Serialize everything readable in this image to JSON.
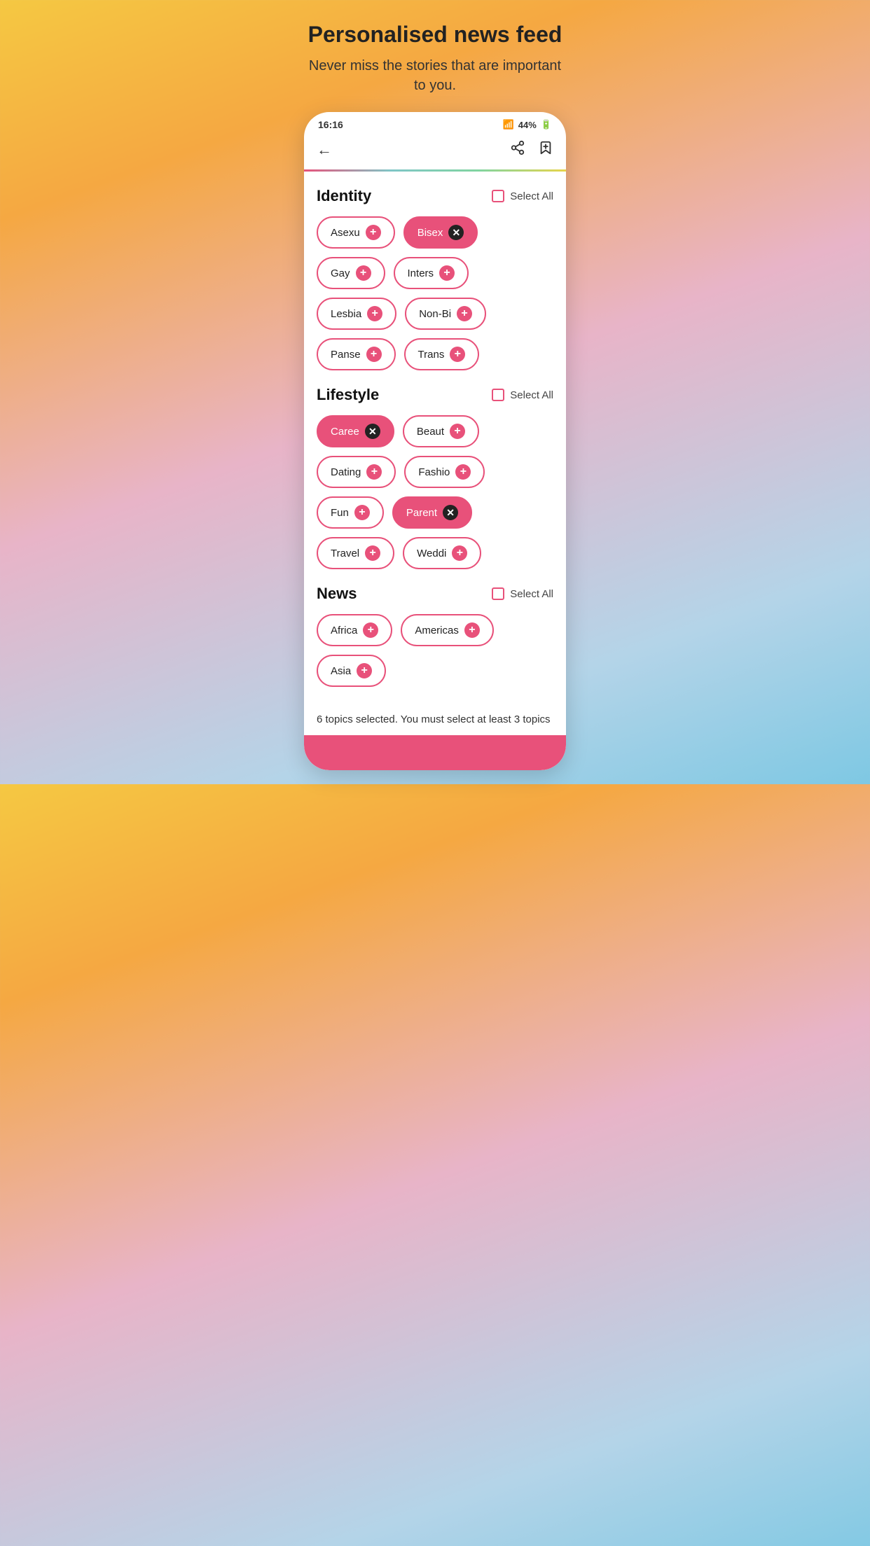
{
  "header": {
    "title": "Personalised news feed",
    "subtitle": "Never miss the stories that are important to you."
  },
  "statusBar": {
    "time": "16:16",
    "battery": "44%",
    "signal": "wifi+bars"
  },
  "nav": {
    "backIcon": "←",
    "shareIcon": "share",
    "bookmarkIcon": "bookmark"
  },
  "sections": [
    {
      "id": "identity",
      "title": "Identity",
      "selectAllLabel": "Select All",
      "tags": [
        {
          "label": "Asexu",
          "state": "default"
        },
        {
          "label": "Bisex",
          "state": "selected"
        },
        {
          "label": "Gay",
          "state": "default"
        },
        {
          "label": "Inters",
          "state": "default"
        },
        {
          "label": "Lesbia",
          "state": "default"
        },
        {
          "label": "Non-Bi",
          "state": "default"
        },
        {
          "label": "Panse",
          "state": "default"
        },
        {
          "label": "Trans",
          "state": "default"
        }
      ]
    },
    {
      "id": "lifestyle",
      "title": "Lifestyle",
      "selectAllLabel": "Select All",
      "tags": [
        {
          "label": "Caree",
          "state": "selected"
        },
        {
          "label": "Beaut",
          "state": "default"
        },
        {
          "label": "Dating",
          "state": "default"
        },
        {
          "label": "Fashio",
          "state": "default"
        },
        {
          "label": "Fun",
          "state": "default"
        },
        {
          "label": "Parent",
          "state": "selected"
        },
        {
          "label": "Travel",
          "state": "default"
        },
        {
          "label": "Weddi",
          "state": "default"
        }
      ]
    },
    {
      "id": "news",
      "title": "News",
      "selectAllLabel": "Select All",
      "tags": [
        {
          "label": "Africa",
          "state": "default"
        },
        {
          "label": "Americas",
          "state": "default"
        },
        {
          "label": "Asia",
          "state": "default"
        }
      ]
    }
  ],
  "footerMessage": "6 topics selected. You must select at least 3 topics"
}
